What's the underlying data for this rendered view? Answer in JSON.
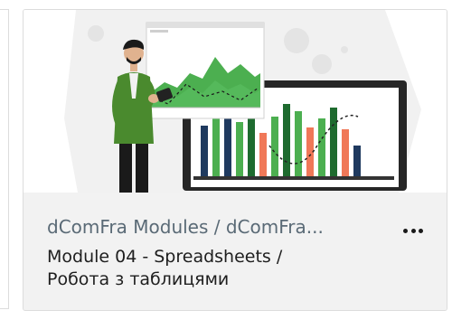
{
  "course_card": {
    "category": "dComFra Modules / dComFra...",
    "title_line1": "Module 04 - Spreadsheets /",
    "title_line2": "Робота з таблицями",
    "more_icon": "ellipsis-icon"
  },
  "colors": {
    "card_border": "#dcdcdc",
    "meta_background": "#f2f2f2",
    "category_text": "#5a6a76",
    "title_text": "#1e1e1e",
    "illustration_green": "#4caf50",
    "illustration_dark_green": "#1e6b2f",
    "illustration_navy": "#1f3a5f",
    "illustration_coral": "#f07858"
  }
}
